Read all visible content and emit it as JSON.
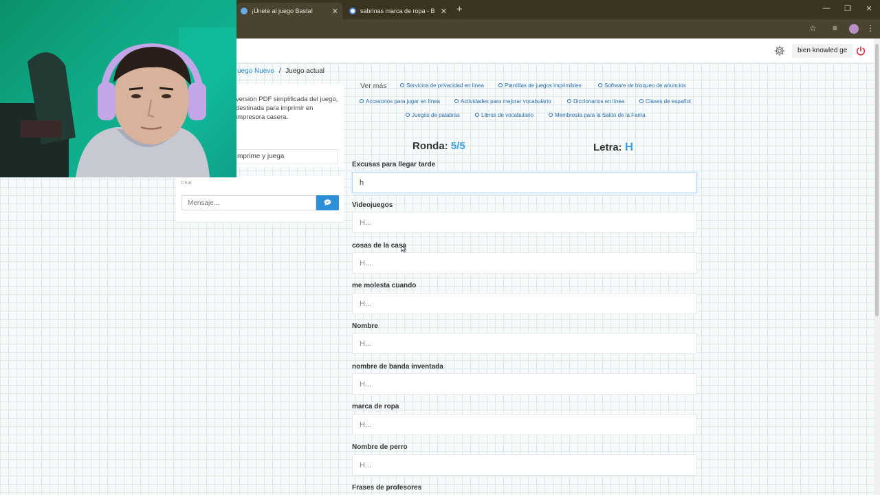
{
  "browser": {
    "tabs": [
      {
        "title": "¡Únete al juego Basta!",
        "active": true
      },
      {
        "title": "sabrinas marca de ropa - Busca",
        "active": false
      }
    ]
  },
  "header": {
    "username": "bien knowled ge"
  },
  "breadcrumb": {
    "link": "uego Nuevo",
    "separator": "/",
    "current": "Juego actual"
  },
  "left_panel": {
    "pdf_description": "versión PDF simplificada del juego, destinada para imprimir en impresora casera.",
    "print_button": "mprime y juega",
    "chat_label": "Chat",
    "chat_placeholder": "Mensaje..."
  },
  "links": {
    "ver_mas": "Ver más",
    "items": [
      "Servicios de privacidad en línea",
      "Plantillas de juegos imprimibles",
      "Software de bloqueo de anuncios",
      "Accesorios para jugar en línea",
      "Actividades para mejorar vocabulario",
      "Diccionarios en línea",
      "Clases de español",
      "Juegos de palabras",
      "Libros de vocabulario",
      "Membresía para la Salón de la Fama"
    ]
  },
  "game": {
    "ronda_label": "Ronda:",
    "ronda_value": "5/5",
    "letra_label": "Letra:",
    "letra_value": "H",
    "categories": [
      {
        "label": "Excusas para llegar tarde",
        "value": "h",
        "placeholder": "H..."
      },
      {
        "label": "Videojuegos",
        "value": "",
        "placeholder": "H..."
      },
      {
        "label": "cosas de la casa",
        "value": "",
        "placeholder": "H..."
      },
      {
        "label": "me molesta cuando",
        "value": "",
        "placeholder": "H..."
      },
      {
        "label": "Nombre",
        "value": "",
        "placeholder": "H..."
      },
      {
        "label": "nombre de banda inventada",
        "value": "",
        "placeholder": "H..."
      },
      {
        "label": "marca de ropa",
        "value": "",
        "placeholder": "H..."
      },
      {
        "label": "Nombre de perro",
        "value": "",
        "placeholder": "H..."
      },
      {
        "label": "Frases de profesores",
        "value": "",
        "placeholder": "H..."
      }
    ]
  },
  "colors": {
    "accent": "#3da0e0",
    "link": "#2a6fb0",
    "chrome_bg": "#3a3420",
    "power_icon": "#e0283a"
  }
}
